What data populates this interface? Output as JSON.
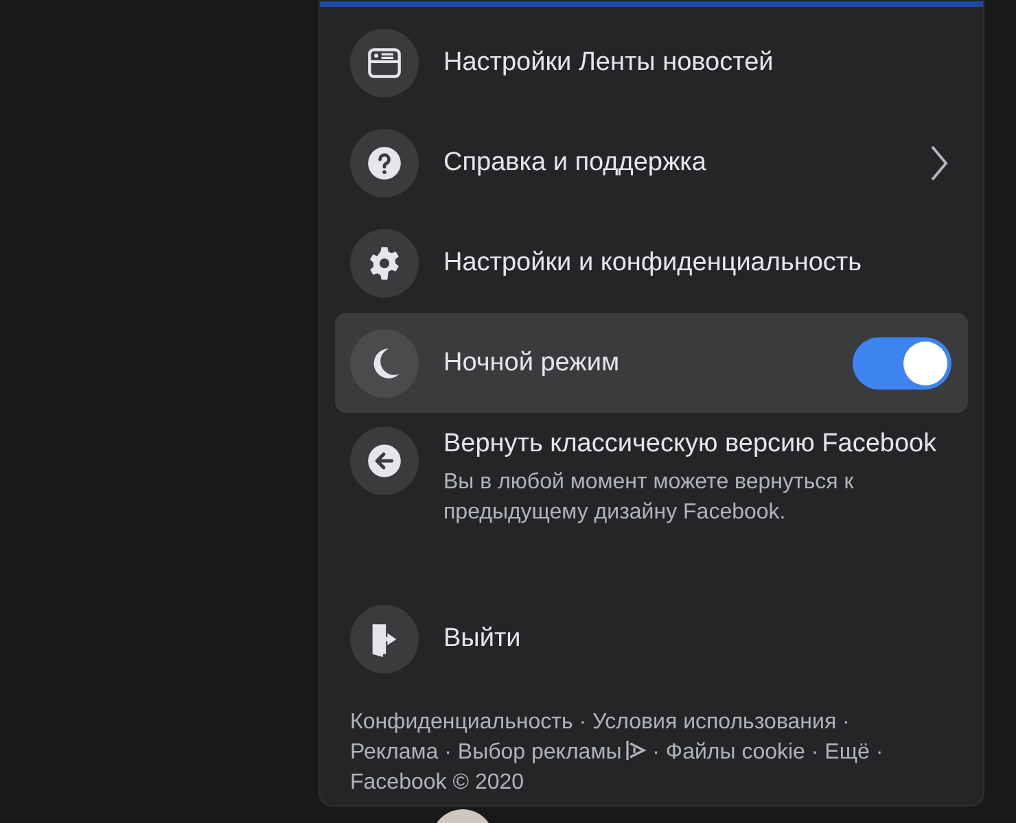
{
  "menu": {
    "items": [
      {
        "kind": "plain",
        "label": "Настройки Ленты новостей",
        "hovered": false
      },
      {
        "kind": "submenu",
        "label": "Справка и поддержка",
        "hovered": false
      },
      {
        "kind": "plain",
        "label": "Настройки и конфиденциальность",
        "hovered": false
      },
      {
        "kind": "toggle",
        "label": "Ночной режим",
        "on": true,
        "hovered": true
      },
      {
        "kind": "described",
        "label": "Вернуть классическую версию Facebook",
        "description": "Вы в любой момент можете вернуться к предыдущему дизайну Facebook.",
        "hovered": false
      },
      {
        "kind": "plain",
        "label": "Выйти",
        "hovered": false
      }
    ],
    "footer": [
      {
        "kind": "link",
        "text": "Конфиденциальность"
      },
      {
        "kind": "link",
        "text": "Условия использования"
      },
      {
        "kind": "link",
        "text": "Реклама"
      },
      {
        "kind": "adchoices",
        "text": "Выбор рекламы"
      },
      {
        "kind": "link",
        "text": "Файлы cookie"
      },
      {
        "kind": "link",
        "text": "Ещё"
      },
      {
        "kind": "text",
        "text": "Facebook © 2020"
      }
    ],
    "separator": "·"
  }
}
